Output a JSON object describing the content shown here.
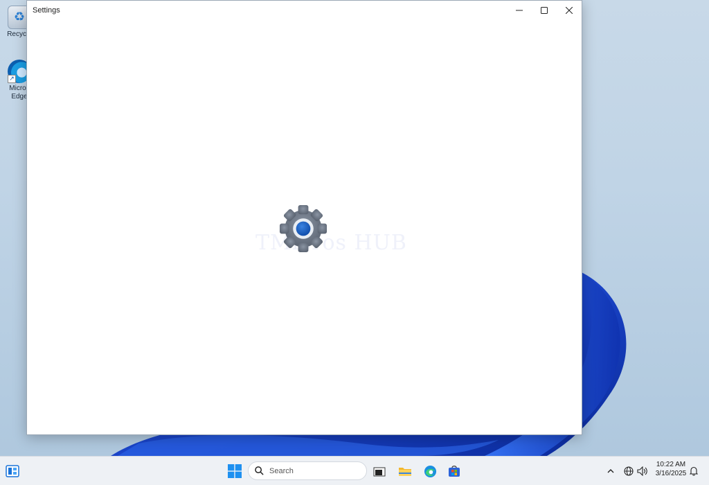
{
  "desktop": {
    "icons": [
      {
        "label": "Recycle",
        "icon": "recycle-bin-icon"
      },
      {
        "label": "Micros",
        "label2": "Edge",
        "icon": "edge-icon"
      }
    ],
    "wallpaper_accent": "#1f4fd1"
  },
  "window": {
    "title": "Settings",
    "controls": {
      "minimize": "minimize-icon",
      "maximize": "maximize-icon",
      "close": "close-icon"
    },
    "splash_icon": "settings-gear-icon",
    "watermark": "TMicros HUB"
  },
  "taskbar": {
    "widgets_icon": "widgets-icon",
    "start_icon": "windows-start-icon",
    "search": {
      "placeholder": "Search",
      "icon": "search-icon"
    },
    "apps": [
      {
        "name": "task-view",
        "icon": "task-view-icon"
      },
      {
        "name": "file-explorer",
        "icon": "folder-icon"
      },
      {
        "name": "edge",
        "icon": "edge-icon"
      },
      {
        "name": "store",
        "icon": "store-icon"
      }
    ],
    "tray": {
      "chevron_icon": "chevron-up-icon",
      "network_icon": "globe-icon",
      "volume_icon": "speaker-icon",
      "notification_icon": "bell-icon"
    },
    "clock": {
      "time": "10:22 AM",
      "date": "3/16/2025"
    }
  },
  "colors": {
    "accent": "#1f5fc0",
    "window_bg": "#ffffff",
    "taskbar_bg": "#eef1f5"
  }
}
